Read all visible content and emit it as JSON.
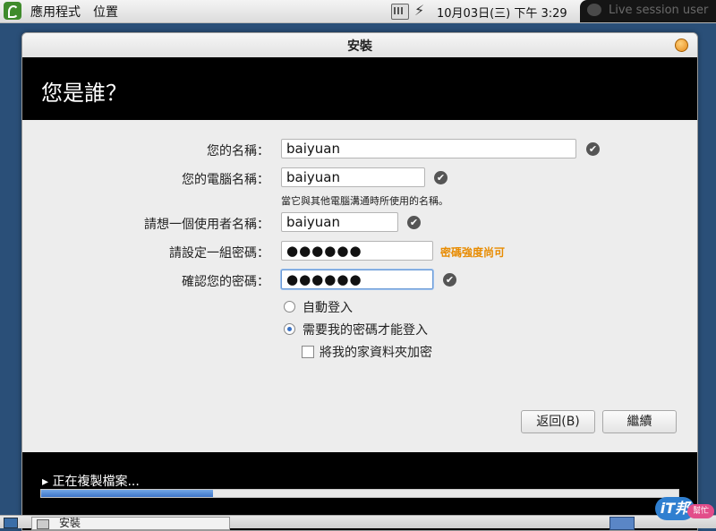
{
  "topbar": {
    "apps_menu": "應用程式",
    "places_menu": "位置",
    "clock": "10月03日(三) 下午  3:29",
    "live_session": "Live session user"
  },
  "window": {
    "title": "安裝",
    "header": "您是誰？"
  },
  "form": {
    "name_label": "您的名稱：",
    "name_value": "baiyuan",
    "computer_label": "您的電腦名稱：",
    "computer_value": "baiyuan",
    "computer_hint": "當它與其他電腦溝通時所使用的名稱。",
    "username_label": "請想一個使用者名稱：",
    "username_value": "baiyuan",
    "password_label": "請設定一組密碼：",
    "password_value": "●●●●●●",
    "password_strength": "密碼強度尚可",
    "confirm_label": "確認您的密碼：",
    "confirm_value": "●●●●●●",
    "auto_login": "自動登入",
    "require_password": "需要我的密碼才能登入",
    "encrypt_home": "將我的家資料夾加密"
  },
  "buttons": {
    "back": "返回(B)",
    "continue": "繼續"
  },
  "progress": {
    "label": "▸ 正在複製檔案...",
    "fraction": 0.27
  },
  "taskbar": {
    "task_label": "安裝"
  },
  "watermark": {
    "logo": "iT邦",
    "badge": "幫忙"
  },
  "colors": {
    "accent": "#3d75c8",
    "strength_warning": "#e88b00",
    "header_bg": "#000000"
  }
}
